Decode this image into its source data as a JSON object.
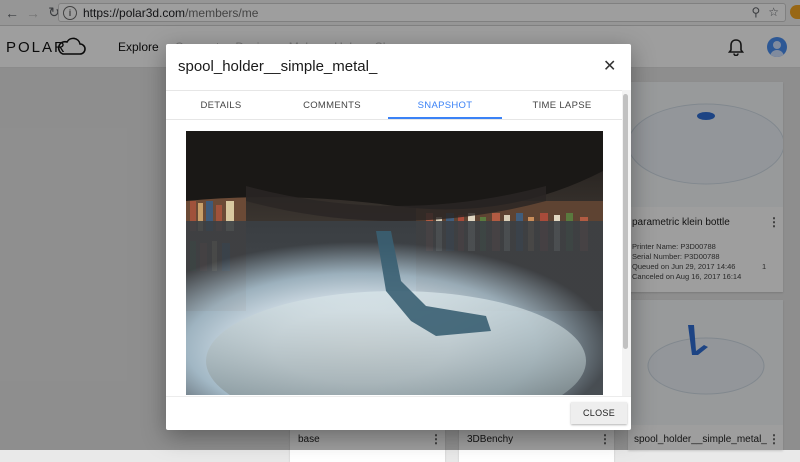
{
  "browser": {
    "url_host": "https://polar3d.com",
    "url_path": "/members/me"
  },
  "header": {
    "logo_text": "POLAR",
    "nav": [
      "Explore",
      "Connect",
      "Design",
      "Make",
      "Help",
      "Shop"
    ]
  },
  "background_cards": [
    {
      "title": "parametric klein bottle",
      "printer_name": "Printer Name: P3D00788",
      "serial": "Serial Number: P3D00788",
      "queued": "Queued on Jun 29, 2017 14:46",
      "canceled": "Canceled on Aug 16, 2017 16:14",
      "count": "1"
    },
    {
      "title": "base"
    },
    {
      "title": "3DBenchy"
    },
    {
      "title": "spool_holder__simple_metal_"
    }
  ],
  "dialog": {
    "title": "spool_holder__simple_metal_",
    "tabs": [
      {
        "label": "DETAILS"
      },
      {
        "label": "COMMENTS"
      },
      {
        "label": "SNAPSHOT"
      },
      {
        "label": "TIME LAPSE"
      }
    ],
    "active_tab": "SNAPSHOT",
    "close_label": "CLOSE"
  },
  "colors": {
    "accent": "#3b82f6",
    "avatar": "#4a8ff0",
    "model_blue": "#2f6fd6"
  },
  "icons": {
    "back": "arrow-left-icon",
    "forward": "arrow-right-icon",
    "reload": "reload-icon",
    "info": "info-icon",
    "zoom": "magnifier-icon",
    "bookmark": "star-icon",
    "cloud": "cloud-logo-icon",
    "bell": "bell-icon",
    "avatar": "account-icon",
    "close": "close-icon"
  }
}
